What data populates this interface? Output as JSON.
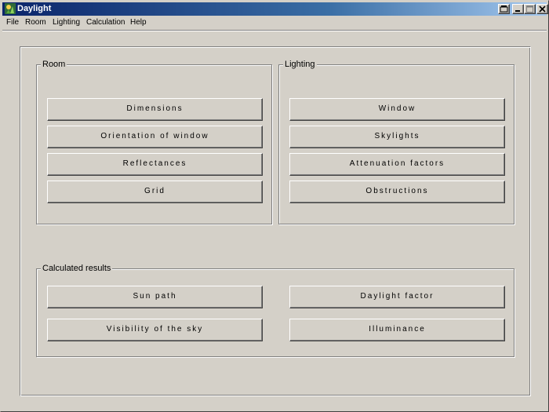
{
  "window": {
    "title": "Daylight",
    "controls": {
      "restore": "‒",
      "minimize": "_",
      "maximize": "□",
      "close": "✕"
    }
  },
  "menu": [
    "File",
    "Room",
    "Lighting",
    "Calculation",
    "Help"
  ],
  "groups": {
    "room": {
      "label": "Room",
      "buttons": [
        "Dimensions",
        "Orientation of window",
        "Reflectances",
        "Grid"
      ]
    },
    "lighting": {
      "label": "Lighting",
      "buttons": [
        "Window",
        "Skylights",
        "Attenuation factors",
        "Obstructions"
      ]
    },
    "results": {
      "label": "Calculated results",
      "buttons": [
        "Sun path",
        "Daylight factor",
        "Visibility of the sky",
        "Illuminance"
      ]
    }
  },
  "icons": [
    "daylight-app-icon",
    "restore-icon",
    "minimize-icon",
    "maximize-icon",
    "close-icon"
  ]
}
